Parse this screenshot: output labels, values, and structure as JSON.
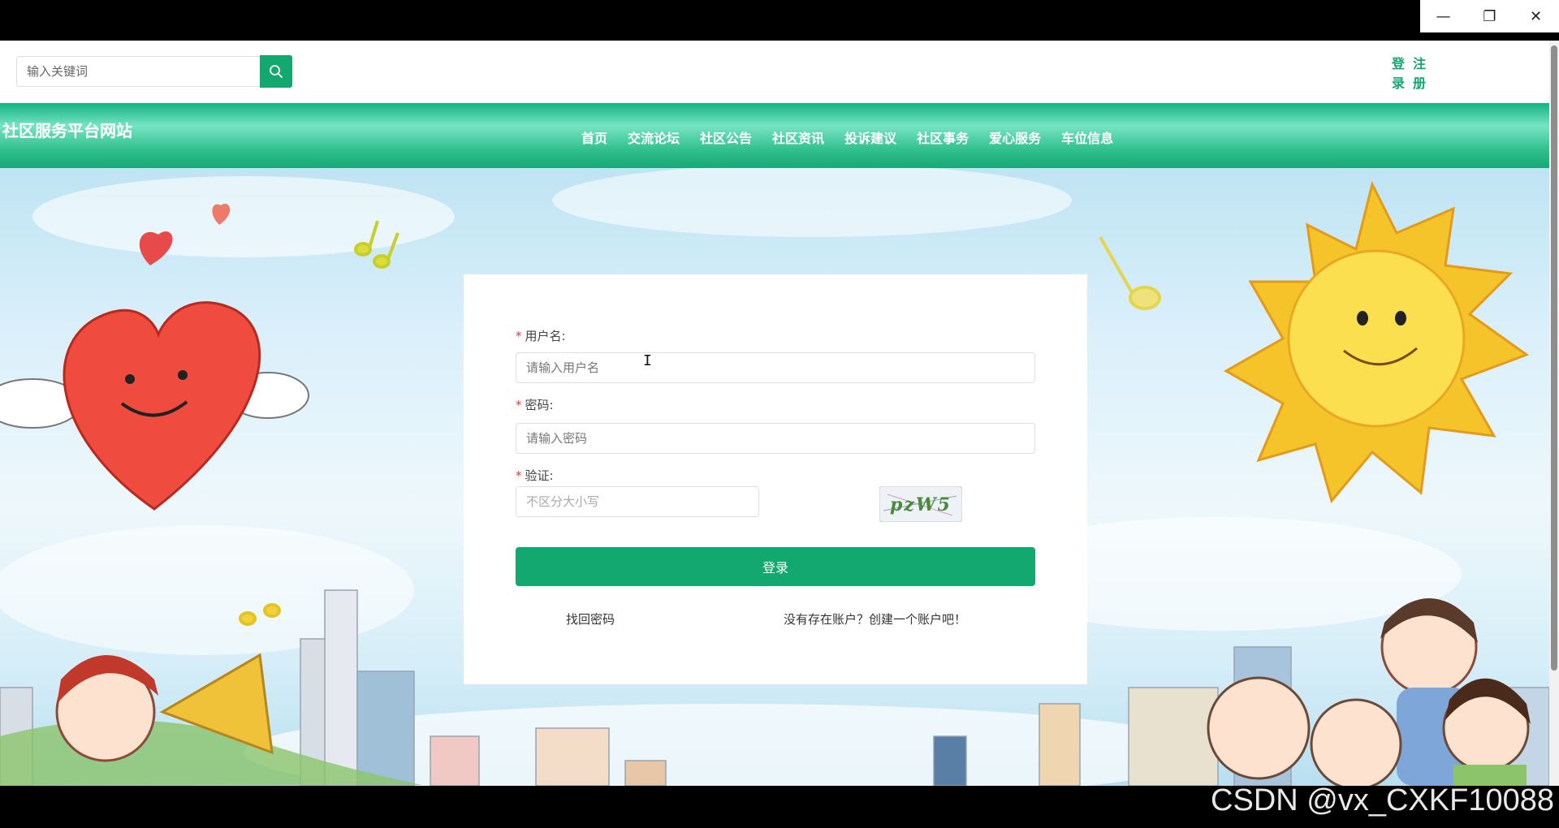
{
  "window": {
    "minimize": "—",
    "restore": "❐",
    "close": "✕"
  },
  "topbar": {
    "search_placeholder": "输入关键词",
    "search_icon": "search-icon",
    "login_link": "登录",
    "register_link": "注册"
  },
  "site": {
    "title": "社区服务平台网站"
  },
  "nav": {
    "items": [
      {
        "label": "首页"
      },
      {
        "label": "交流论坛"
      },
      {
        "label": "社区公告"
      },
      {
        "label": "社区资讯"
      },
      {
        "label": "投诉建议"
      },
      {
        "label": "社区事务"
      },
      {
        "label": "爱心服务"
      },
      {
        "label": "车位信息"
      }
    ]
  },
  "login": {
    "username_label": "用户名:",
    "username_placeholder": "请输入用户名",
    "password_label": "密码:",
    "password_placeholder": "请输入密码",
    "captcha_label": "验证:",
    "captcha_placeholder": "不区分大小写",
    "captcha_text": "pzW5",
    "submit_label": "登录",
    "forgot_password": "找回密码",
    "register_prompt": "没有存在账户？创建一个账户吧！",
    "required_mark": "*"
  },
  "colors": {
    "accent": "#12a86f",
    "nav_light": "#76e4c2"
  },
  "watermark": "CSDN @vx_CXKF10088"
}
